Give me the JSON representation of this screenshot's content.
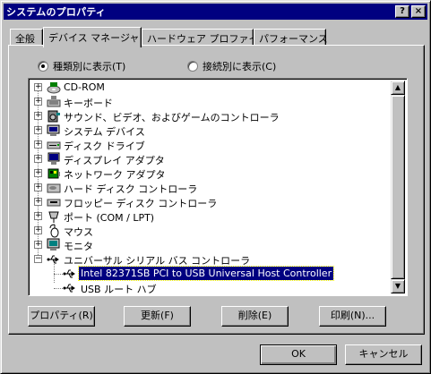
{
  "window": {
    "title": "システムのプロパティ",
    "help_glyph": "?",
    "close_glyph": "×"
  },
  "tabs": [
    {
      "label": "全般",
      "active": false
    },
    {
      "label": "デバイス マネージャ",
      "active": true
    },
    {
      "label": "ハードウェア プロファイル",
      "active": false
    },
    {
      "label": "パフォーマンス",
      "active": false
    }
  ],
  "view_options": {
    "by_type": {
      "label": "種類別に表示(T)",
      "selected": true
    },
    "by_connection": {
      "label": "接続別に表示(C)",
      "selected": false
    }
  },
  "tree": {
    "items": [
      {
        "label": "CD-ROM",
        "icon": "cdrom-icon",
        "expander": "+"
      },
      {
        "label": "キーボード",
        "icon": "keyboard-icon",
        "expander": "+"
      },
      {
        "label": "サウンド、ビデオ、およびゲームのコントローラ",
        "icon": "sound-icon",
        "expander": "+"
      },
      {
        "label": "システム デバイス",
        "icon": "system-device-icon",
        "expander": "+"
      },
      {
        "label": "ディスク ドライブ",
        "icon": "disk-drive-icon",
        "expander": "+"
      },
      {
        "label": "ディスプレイ アダプタ",
        "icon": "display-adapter-icon",
        "expander": "+"
      },
      {
        "label": "ネットワーク アダプタ",
        "icon": "network-adapter-icon",
        "expander": "+"
      },
      {
        "label": "ハード ディスク コントローラ",
        "icon": "hdd-controller-icon",
        "expander": "+"
      },
      {
        "label": "フロッピー ディスク コントローラ",
        "icon": "floppy-controller-icon",
        "expander": "+"
      },
      {
        "label": "ポート (COM / LPT)",
        "icon": "port-icon",
        "expander": "+"
      },
      {
        "label": "マウス",
        "icon": "mouse-icon",
        "expander": "+"
      },
      {
        "label": "モニタ",
        "icon": "monitor-icon",
        "expander": "+"
      },
      {
        "label": "ユニバーサル シリアル バス コントローラ",
        "icon": "usb-icon",
        "expander": "−"
      }
    ],
    "children": [
      {
        "label": "Intel 82371SB PCI to USB Universal Host Controller",
        "icon": "usb-icon",
        "selected": true
      },
      {
        "label": "USB ルート ハブ",
        "icon": "usb-icon",
        "selected": false
      }
    ]
  },
  "scrollbar": {
    "up_glyph": "▲",
    "down_glyph": "▼"
  },
  "action_buttons": {
    "properties": "プロパティ(R)",
    "refresh": "更新(F)",
    "remove": "削除(E)",
    "print": "印刷(N)..."
  },
  "dialog_buttons": {
    "ok": "OK",
    "cancel": "キャンセル"
  }
}
